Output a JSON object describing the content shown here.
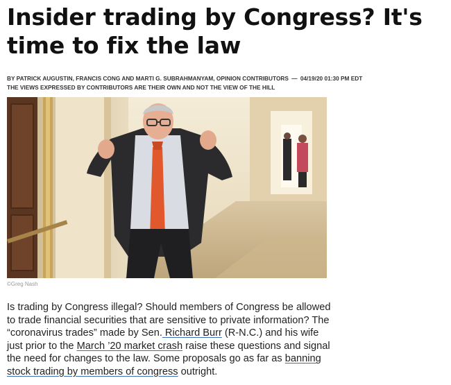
{
  "article": {
    "headline": "Insider trading by Congress? It's time to fix the law",
    "byline": {
      "authors": "BY PATRICK AUGUSTIN, FRANCIS CONG AND MARTI G. SUBRAHMANYAM, OPINION CONTRIBUTORS",
      "separator": "—",
      "timestamp": "04/19/20 01:30 PM EDT"
    },
    "disclaimer": "THE VIEWS EXPRESSED BY CONTRIBUTORS ARE THEIR OWN AND NOT THE VIEW OF THE HILL",
    "photo_credit": "©Greg Nash",
    "paragraph": {
      "p1": "Is trading by Congress illegal? Should members of Congress be allowed to trade financial securities that are sensitive to private information? The “coronavirus trades” made by Sen.",
      "link1": " Richard Burr",
      "p2": " (R-N.C.) and his wife just prior to the ",
      "link2": "March ’20 market crash",
      "p3": " raise these questions and signal the need for changes to the law. Some proposals go as far as ",
      "link3": "banning stock trading by members of congress",
      "p4": " outright."
    }
  },
  "colors": {
    "link_underline": "#3b6fb5",
    "headline": "#111111",
    "body": "#222222"
  }
}
